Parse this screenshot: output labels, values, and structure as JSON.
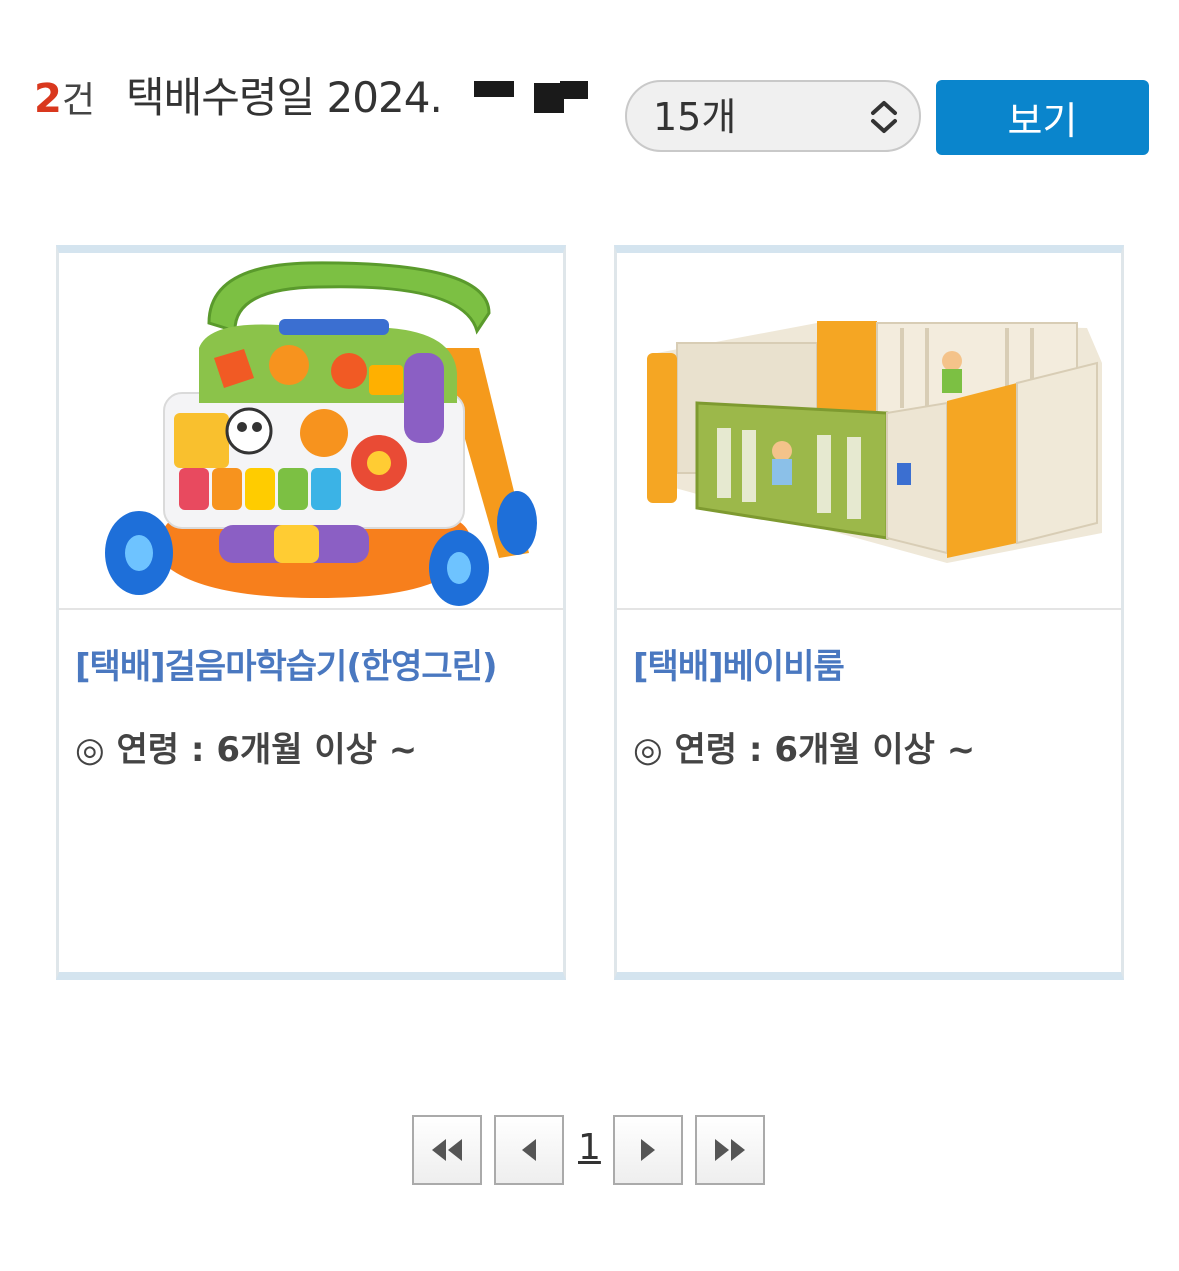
{
  "header": {
    "count_num": "2",
    "count_unit": "건",
    "date_label": "택배수령일 2024.",
    "select_value": "15개",
    "view_button": "보기"
  },
  "items": [
    {
      "title": "[택배]걸음마학습기(한영그린)",
      "age": "◎ 연령 : 6개월 이상 ~"
    },
    {
      "title": "[택배]베이비룸",
      "age": "◎ 연령 : 6개월 이상 ~"
    }
  ],
  "pagination": {
    "current_page": "1"
  },
  "colors": {
    "accent_red": "#d9381e",
    "button_blue": "#0a85cc",
    "title_blue": "#4a78c0"
  }
}
